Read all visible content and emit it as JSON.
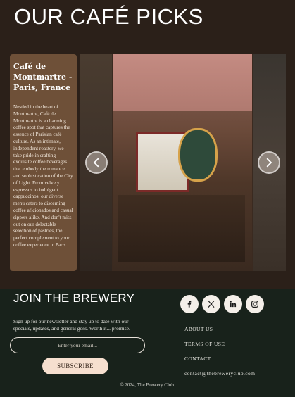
{
  "header": {
    "title": "OUR CAFÉ PICKS"
  },
  "card": {
    "title": "Café de Montmartre - Paris, France",
    "description": "Nestled in the heart of Montmartre, Café de Montmartre is a charming coffee spot that captures the essence of Parisian café culture. As an intimate, independent roastery, we take pride in crafting exquisite coffee beverages that embody the romance and sophistication of the City of Light. From velvety espressos to indulgent cappuccinos, our diverse menu caters to discerning coffee aficionados and casual sippers alike. And don't miss out on our delectable selection of pastries, the perfect complement to your coffee experience in Paris."
  },
  "gallery": {
    "prev_icon": "chevron-left-icon",
    "next_icon": "chevron-right-icon"
  },
  "footer": {
    "join_title": "JOIN THE BREWERY",
    "newsletter_text": "Sign up for our newsletter and stay up to date with our specials, updates, and general goss. Worth it... promise.",
    "email_placeholder": "Enter your email...",
    "subscribe_label": "SUBSCRIBE",
    "socials": [
      "facebook-icon",
      "x-icon",
      "linkedin-icon",
      "instagram-icon"
    ],
    "links": [
      "ABOUT US",
      "TERMS OF USE",
      "CONTACT",
      "contact@thebreweryclub.com"
    ],
    "copyright": "© 2024, The Brewery Club."
  }
}
